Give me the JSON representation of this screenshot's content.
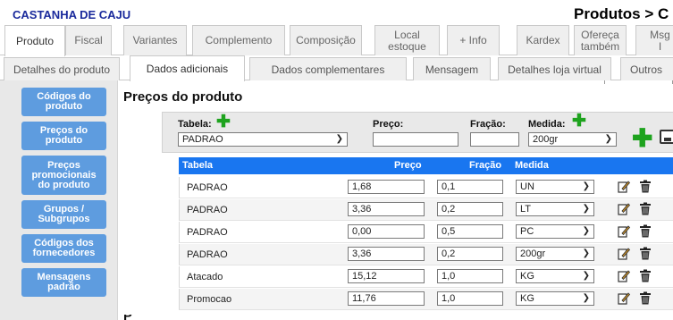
{
  "header": {
    "product_name": "CASTANHA DE CAJU",
    "breadcrumb": "Produtos > C"
  },
  "main_tabs": [
    {
      "label": "Produto",
      "active": true
    },
    {
      "label": "Fiscal"
    },
    {
      "label": "Variantes"
    },
    {
      "label": "Complemento"
    },
    {
      "label": "Composição"
    },
    {
      "label": "Local estoque"
    },
    {
      "label": "+ Info"
    },
    {
      "label": "Kardex"
    },
    {
      "label": "Ofereça também"
    },
    {
      "label": "Msg I"
    }
  ],
  "sub_tabs": [
    {
      "label": "Detalhes do produto"
    },
    {
      "label": "Dados adicionais",
      "active": true
    },
    {
      "label": "Dados complementares"
    },
    {
      "label": "Mensagem"
    },
    {
      "label": "Detalhes loja virtual"
    },
    {
      "label": "Outros"
    }
  ],
  "sidebar": {
    "items": [
      {
        "label": "Códigos do produto"
      },
      {
        "label": "Preços do produto"
      },
      {
        "label": "Preços promocionais do produto"
      },
      {
        "label": "Grupos / Subgrupos"
      },
      {
        "label": "Códigos dos fornecedores"
      },
      {
        "label": "Mensagens padrão"
      }
    ]
  },
  "section": {
    "title": "Preços do produto",
    "bottom_title": "P"
  },
  "form": {
    "tabela_label": "Tabela:",
    "tabela_value": "PADRAO",
    "preco_label": "Preço:",
    "preco_value": "",
    "fracao_label": "Fração:",
    "fracao_value": "",
    "medida_label": "Medida:",
    "medida_value": "200gr",
    "add_icon": "plus-icon",
    "save_icon": "save-icon",
    "accent_color": "#1ea31e"
  },
  "table": {
    "header_color": "#1976f0",
    "columns": [
      "Tabela",
      "Preço",
      "Fração",
      "Medida"
    ],
    "rows": [
      {
        "tabela": "PADRAO",
        "preco": "1,68",
        "fracao": "0,1",
        "medida": "UN"
      },
      {
        "tabela": "PADRAO",
        "preco": "3,36",
        "fracao": "0,2",
        "medida": "LT"
      },
      {
        "tabela": "PADRAO",
        "preco": "0,00",
        "fracao": "0,5",
        "medida": "PC"
      },
      {
        "tabela": "PADRAO",
        "preco": "3,36",
        "fracao": "0,2",
        "medida": "200gr"
      },
      {
        "tabela": "Atacado",
        "preco": "15,12",
        "fracao": "1,0",
        "medida": "KG"
      },
      {
        "tabela": "Promocao",
        "preco": "11,76",
        "fracao": "1,0",
        "medida": "KG"
      }
    ],
    "row_icons": [
      "edit-icon",
      "trash-icon"
    ]
  }
}
